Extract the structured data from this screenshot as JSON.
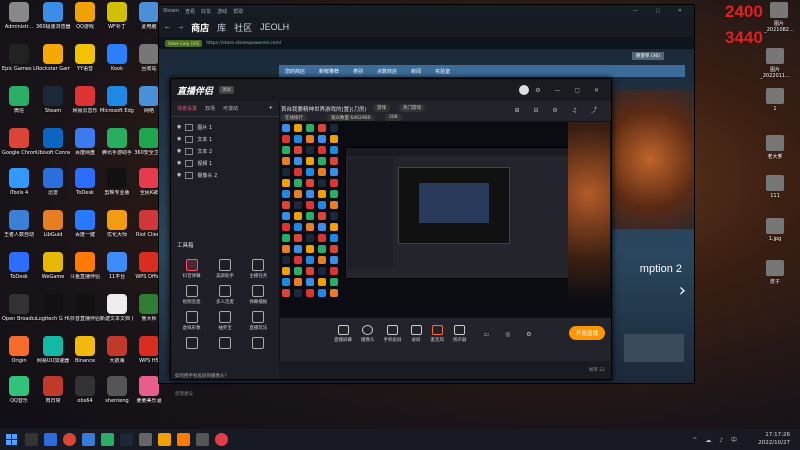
{
  "desktop": {
    "left_icons": [
      {
        "label": "Administr...",
        "color": "#888"
      },
      {
        "label": "360极速浏览器",
        "color": "#3a8ee6"
      },
      {
        "label": "QQ游戏",
        "color": "#f0a000"
      },
      {
        "label": "WF补丁",
        "color": "#d0c000"
      },
      {
        "label": "此电脑",
        "color": "#4a90d9"
      },
      {
        "label": "Epic Games Launcher",
        "color": "#222"
      },
      {
        "label": "Rockstar Games...",
        "color": "#f5a800"
      },
      {
        "label": "YY语音",
        "color": "#f2c200"
      },
      {
        "label": "Kook",
        "color": "#2b7fff"
      },
      {
        "label": "回收站",
        "color": "#777"
      },
      {
        "label": "微信",
        "color": "#2aae67"
      },
      {
        "label": "Steam",
        "color": "#1b2838"
      },
      {
        "label": "网易云音乐",
        "color": "#d33"
      },
      {
        "label": "Microsoft Edge",
        "color": "#1e88e5"
      },
      {
        "label": "网络",
        "color": "#4a90d9"
      },
      {
        "label": "Google Chrome",
        "color": "#db4437"
      },
      {
        "label": "Ubisoft Connect",
        "color": "#0a66c2"
      },
      {
        "label": "百度网盘",
        "color": "#3b7bef"
      },
      {
        "label": "腾讯手游助手",
        "color": "#27ae60"
      },
      {
        "label": "360安全卫士",
        "color": "#1ea64c"
      },
      {
        "label": "iTools 4",
        "color": "#3399ff"
      },
      {
        "label": "迅雷",
        "color": "#2a6fdb"
      },
      {
        "label": "ToDesk",
        "color": "#2c6dff"
      },
      {
        "label": "剪映专业版",
        "color": "#111"
      },
      {
        "label": "全民K歌",
        "color": "#e63b4a"
      },
      {
        "label": "王者人数自动",
        "color": "#3c7fd6"
      },
      {
        "label": "LibGuid",
        "color": "#e67e22"
      },
      {
        "label": "百度一键",
        "color": "#2979ff"
      },
      {
        "label": "优化大师",
        "color": "#f39c12"
      },
      {
        "label": "Riot Client",
        "color": "#d13639"
      },
      {
        "label": "ToDesk",
        "color": "#2c6dff"
      },
      {
        "label": "WeGame",
        "color": "#e6b800"
      },
      {
        "label": "斗鱼直播伴侣",
        "color": "#ff7a00"
      },
      {
        "label": "11平台",
        "color": "#3d8bfd"
      },
      {
        "label": "WPS Office",
        "color": "#d92d20"
      },
      {
        "label": "Open Broadcast...",
        "color": "#333"
      },
      {
        "label": "Logitech G HUB",
        "color": "#111"
      },
      {
        "label": "抖音直播伴侣",
        "color": "#111"
      },
      {
        "label": "新建文本文档 (4)",
        "color": "#eee"
      },
      {
        "label": "鲁大师",
        "color": "#2e7d32"
      },
      {
        "label": "Origin",
        "color": "#f56c2d"
      },
      {
        "label": "网易UU加速器",
        "color": "#14b8a6"
      },
      {
        "label": "Binance",
        "color": "#f0b90b"
      },
      {
        "label": "大航海",
        "color": "#c0392b"
      },
      {
        "label": "WPS H5",
        "color": "#d92d20"
      },
      {
        "label": "QQ音乐",
        "color": "#31c27c"
      },
      {
        "label": "肉日常",
        "color": "#c0392b"
      },
      {
        "label": "obs64",
        "color": "#333"
      },
      {
        "label": "shenteng",
        "color": "#555"
      },
      {
        "label": "姜姜美乐涵",
        "color": "#e85d8a"
      }
    ],
    "right_overlay": {
      "number_1": "2400",
      "number_2": "3440",
      "icons": [
        {
          "label": "图片_2021082..."
        },
        {
          "label": "图片_2022011..."
        },
        {
          "label": "1"
        },
        {
          "label": "老大爹"
        },
        {
          "label": "111"
        },
        {
          "label": "1.jpg"
        },
        {
          "label": "皮子"
        }
      ]
    }
  },
  "steam": {
    "topbar": [
      "Steam",
      "查看",
      "好友",
      "游戏",
      "帮助"
    ],
    "nav": {
      "store": "商店",
      "library": "库",
      "community": "社区",
      "user": "JEOLH"
    },
    "url_badge": "Valve Corp [US]",
    "url": "https://store.steampowered.com/",
    "store_nav": [
      "您的商店",
      "新鲜推荐",
      "类别",
      "点数商店",
      "新闻",
      "实验室"
    ],
    "wishlist": "愿望单 (36)",
    "promo_text": "mption 2"
  },
  "live_app": {
    "logo": "直播伴侣",
    "version": "测试",
    "tabs": [
      "场景设置",
      "双场",
      "可滚动"
    ],
    "scenes": [
      "图片 1",
      "文本 1",
      "文本 2",
      "视频 1",
      "摄像头 2"
    ],
    "tool_title": "工具箱",
    "tools": [
      "抖音弹幕",
      "美颜助手",
      "主播任务",
      "视频连麦",
      "多人连麦",
      "弹幕播报",
      "虚拟形象",
      "抽奖宝",
      "直播玩法",
      "",
      "",
      ""
    ],
    "help": "如何把手机投屏到摄像头？",
    "feedback": "反馈建议",
    "stream_title": "首自我要精神世界游戏的[置](刀房)",
    "pill_1": "游戏",
    "pill_2": "热门游戏",
    "pill_3": "在线排行",
    "pill_4": "观众数量 6462960",
    "pill_5": "208",
    "bottom_tools": [
      "直播屏幕",
      "摄像头",
      "手机投屏",
      "录屏",
      "麦克风",
      "扬声器"
    ],
    "start_btn": "开始直播",
    "status_left": "",
    "status_right": "帧率 22"
  },
  "taskbar": {
    "time": "17:17:26",
    "date": "2022/10/27"
  }
}
